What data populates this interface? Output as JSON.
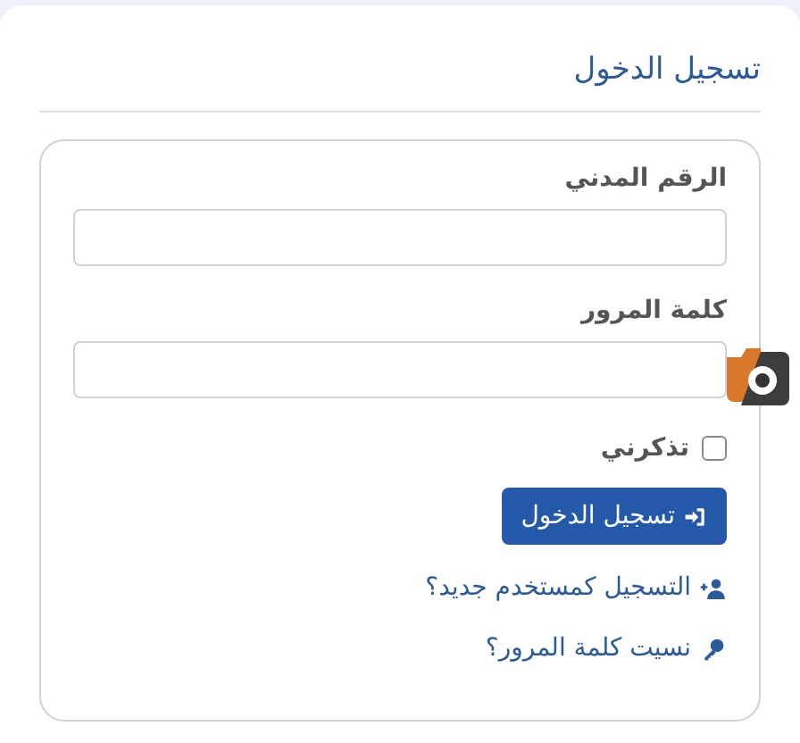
{
  "title": "تسجيل الدخول",
  "fields": [
    {
      "label": "الرقم المدني"
    },
    {
      "label": "كلمة المرور"
    }
  ],
  "remember": {
    "label": "تذكرني",
    "checked": false
  },
  "submit": {
    "label": "تسجيل الدخول"
  },
  "links": [
    {
      "label": "التسجيل كمستخدم جديد؟",
      "kind": "register"
    },
    {
      "label": "نسيت كلمة المرور؟",
      "kind": "forgot"
    }
  ]
}
